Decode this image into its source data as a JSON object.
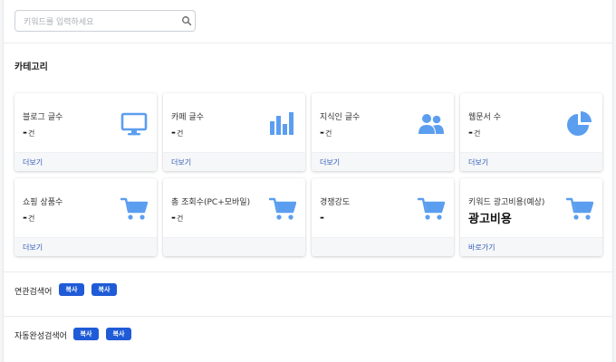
{
  "search": {
    "placeholder": "키워드를 입력하세요",
    "value": ""
  },
  "category": {
    "title": "카테고리",
    "cards": [
      {
        "label": "블로그 글수",
        "value": "-",
        "unit": "건",
        "link": "더보기",
        "icon": "monitor-icon"
      },
      {
        "label": "카페 글수",
        "value": "-",
        "unit": "건",
        "link": "더보기",
        "icon": "bar-chart-icon"
      },
      {
        "label": "지식인 글수",
        "value": "-",
        "unit": "건",
        "link": "더보기",
        "icon": "users-icon"
      },
      {
        "label": "웹문서 수",
        "value": "-",
        "unit": "건",
        "link": "더보기",
        "icon": "pie-chart-icon"
      },
      {
        "label": "쇼핑 상품수",
        "value": "-",
        "unit": "건",
        "link": "더보기",
        "icon": "cart-icon"
      },
      {
        "label": "총 조회수(PC+모바일)",
        "value": "-",
        "unit": "건",
        "link": "",
        "icon": "cart-icon"
      },
      {
        "label": "경쟁강도",
        "value": "-",
        "unit": "",
        "link": "",
        "icon": "cart-icon"
      },
      {
        "label": "키워드 광고비용(예상)",
        "value": "광고비용",
        "unit": "",
        "link": "바로가기",
        "icon": "cart-icon"
      }
    ]
  },
  "related": {
    "label": "연관검색어",
    "buttons": [
      "복사",
      "복사"
    ]
  },
  "autocomplete": {
    "label": "자동완성검색어",
    "buttons": [
      "복사",
      "복사"
    ]
  },
  "colors": {
    "accent": "#1f5bd6",
    "icon": "#5b9ef0",
    "link": "#2f5bb7"
  }
}
